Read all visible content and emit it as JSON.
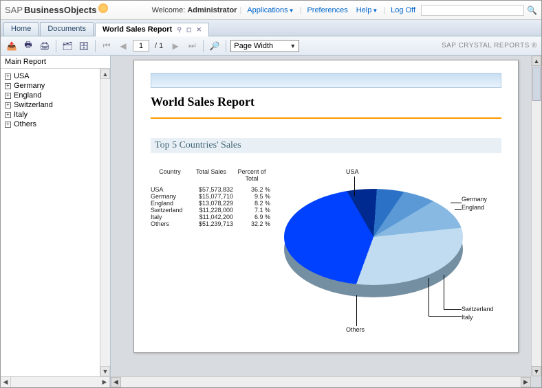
{
  "header": {
    "logo_prefix": "SAP ",
    "logo_main": "Business",
    "logo_suffix": "Objects",
    "welcome_prefix": "Welcome: ",
    "welcome_user": "Administrator",
    "links": {
      "applications": "Applications",
      "preferences": "Preferences",
      "help": "Help",
      "logoff": "Log Off"
    },
    "search_placeholder": ""
  },
  "tabs": {
    "home": "Home",
    "documents": "Documents",
    "report": "World Sales Report"
  },
  "toolbar": {
    "page_current": "1",
    "page_sep": "/",
    "page_total": "1",
    "zoom": "Page Width",
    "brand": "SAP CRYSTAL REPORTS ®"
  },
  "sidebar": {
    "header": "Main Report",
    "items": [
      "USA",
      "Germany",
      "England",
      "Switzerland",
      "Italy",
      "Others"
    ]
  },
  "report": {
    "title": "World Sales Report",
    "section": "Top 5 Countries' Sales",
    "table": {
      "headers": {
        "country": "Country",
        "sales": "Total Sales",
        "pct": "Percent of Total"
      },
      "rows": [
        {
          "country": "USA",
          "sales": "$57,573,832",
          "pct": "36.2 %"
        },
        {
          "country": "Germany",
          "sales": "$15,077,710",
          "pct": "9.5 %"
        },
        {
          "country": "England",
          "sales": "$13,078,229",
          "pct": "8.2 %"
        },
        {
          "country": "Switzerland",
          "sales": "$11,228,000",
          "pct": "7.1 %"
        },
        {
          "country": "Italy",
          "sales": "$11,042,200",
          "pct": "6.9 %"
        },
        {
          "country": "Others",
          "sales": "$51,239,713",
          "pct": "32.2 %"
        }
      ]
    },
    "pie_labels": {
      "usa": "USA",
      "germany": "Germany",
      "england": "England",
      "switzerland": "Switzerland",
      "italy": "Italy",
      "others": "Others"
    }
  },
  "chart_data": {
    "type": "pie",
    "title": "Top 5 Countries' Sales",
    "series": [
      {
        "name": "USA",
        "value": 57573832,
        "percent": 36.2
      },
      {
        "name": "Germany",
        "value": 15077710,
        "percent": 9.5
      },
      {
        "name": "England",
        "value": 13078229,
        "percent": 8.2
      },
      {
        "name": "Switzerland",
        "value": 11228000,
        "percent": 7.1
      },
      {
        "name": "Italy",
        "value": 11042200,
        "percent": 6.9
      },
      {
        "name": "Others",
        "value": 51239713,
        "percent": 32.2
      }
    ]
  }
}
